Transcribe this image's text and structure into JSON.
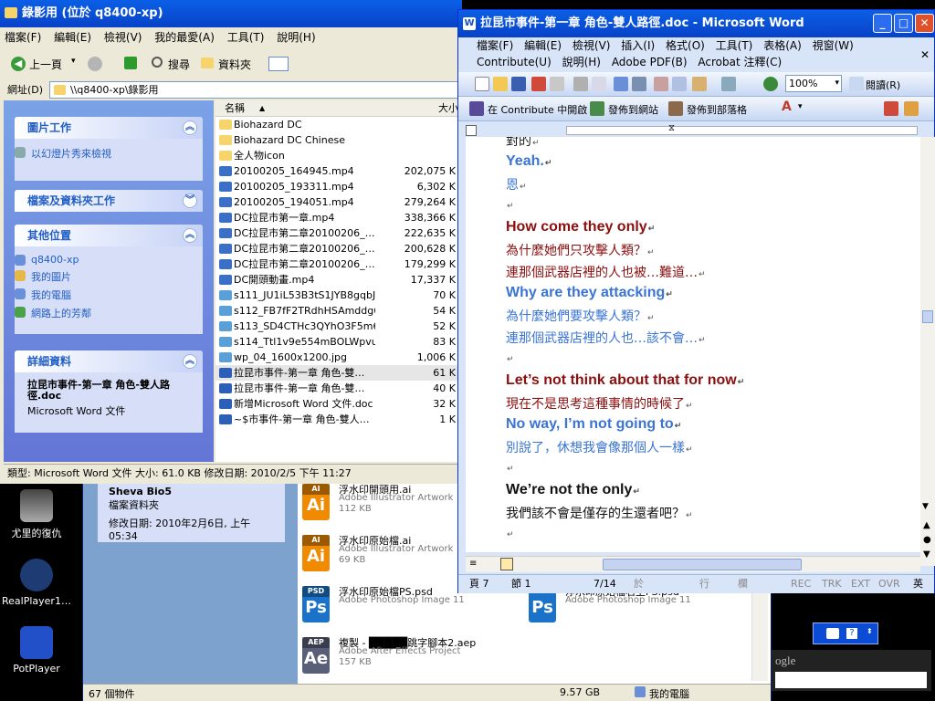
{
  "desktop": {
    "icons": [
      {
        "label": "尤里的復仇"
      },
      {
        "label": "RealPlayer1…"
      },
      {
        "label": "PotPlayer"
      }
    ]
  },
  "back_window": {
    "panel": {
      "title": "Sheva Bio5",
      "type": "檔案資料夾",
      "modified": "修改日期: 2010年2月6日, 上午 05:34"
    },
    "tiles": [
      {
        "badge": "AI",
        "glyph": "Ai",
        "name": "浮水印開頭用.ai",
        "type": "Adobe Illustrator Artwork",
        "size": "112 KB",
        "color": "#f08a00"
      },
      {
        "badge": "AI",
        "glyph": "Ai",
        "name": "浮水印原始檔.ai",
        "type": "Adobe Illustrator Artwork",
        "size": "69 KB",
        "color": "#f08a00"
      },
      {
        "badge": "PSD",
        "glyph": "Ps",
        "name": "浮水印原始檔PS.psd",
        "type": "Adobe Photoshop Image 11",
        "size": "",
        "color": "#1a73c8"
      },
      {
        "badge": "",
        "glyph": "Ps",
        "name": "浮水印原始檔右上PS.psd",
        "type": "Adobe Photoshop Image 11",
        "size": "",
        "color": "#1a73c8"
      },
      {
        "badge": "AEP",
        "glyph": "Ae",
        "name": "複製 - █████跳字腳本2.aep",
        "type": "Adobe After Effects Project",
        "size": "157 KB",
        "color": "#5a5f78"
      }
    ],
    "status": {
      "count": "67 個物件",
      "size": "9.57 GB",
      "location": "我的電腦"
    }
  },
  "explorer": {
    "title": "錄影用 (位於 q8400-xp)",
    "menu": [
      "檔案(F)",
      "編輯(E)",
      "檢視(V)",
      "我的最愛(A)",
      "工具(T)",
      "說明(H)"
    ],
    "toolbar": {
      "back": "上一頁",
      "search": "搜尋",
      "folders": "資料夾"
    },
    "address_label": "網址(D)",
    "address": "\\\\q8400-xp\\錄影用",
    "panels": {
      "picture_tasks": {
        "title": "圖片工作",
        "items": [
          "以幻燈片秀來檢視"
        ]
      },
      "file_tasks": {
        "title": "檔案及資料夾工作"
      },
      "other_places": {
        "title": "其他位置",
        "items": [
          "q8400-xp",
          "我的圖片",
          "我的電腦",
          "網路上的芳鄰"
        ]
      },
      "details": {
        "title": "詳細資料",
        "name": "拉昆市事件-第一章 角色-雙人路徑.doc",
        "type": "Microsoft Word 文件"
      }
    },
    "columns": {
      "name": "名稱",
      "size": "大小"
    },
    "files": [
      {
        "name": "Biohazard DC",
        "size": "",
        "kind": "folder"
      },
      {
        "name": "Biohazard DC Chinese",
        "size": "",
        "kind": "folder"
      },
      {
        "name": "全人物icon",
        "size": "",
        "kind": "folder"
      },
      {
        "name": "20100205_164945.mp4",
        "size": "202,075 K",
        "kind": "video"
      },
      {
        "name": "20100205_193311.mp4",
        "size": "6,302 K",
        "kind": "video"
      },
      {
        "name": "20100205_194051.mp4",
        "size": "279,264 K",
        "kind": "video"
      },
      {
        "name": "DC拉昆市第一章.mp4",
        "size": "338,366 K",
        "kind": "video"
      },
      {
        "name": "DC拉昆市第二章20100206_…",
        "size": "222,635 K",
        "kind": "video"
      },
      {
        "name": "DC拉昆市第二章20100206_…",
        "size": "200,628 K",
        "kind": "video"
      },
      {
        "name": "DC拉昆市第二章20100206_…",
        "size": "179,299 K",
        "kind": "video"
      },
      {
        "name": "DC開頭動畫.mp4",
        "size": "17,337 K",
        "kind": "video"
      },
      {
        "name": "s111_JU1iL53B3tS1JYB8gqbJ…",
        "size": "70 K",
        "kind": "image"
      },
      {
        "name": "s112_FB7fF2TRdhHSAmddg6…",
        "size": "54 K",
        "kind": "image"
      },
      {
        "name": "s113_SD4CTHc3QYhO3F5m6…",
        "size": "52 K",
        "kind": "image"
      },
      {
        "name": "s114_Ttl1v9e554mBOLWpvu…",
        "size": "83 K",
        "kind": "image"
      },
      {
        "name": "wp_04_1600x1200.jpg",
        "size": "1,006 K",
        "kind": "image"
      },
      {
        "name": "拉昆市事件-第一章 角色-雙…",
        "size": "61 K",
        "kind": "doc"
      },
      {
        "name": "拉昆市事件-第一章 角色-雙…",
        "size": "40 K",
        "kind": "doc"
      },
      {
        "name": "新增Microsoft Word 文件.doc",
        "size": "32 K",
        "kind": "doc"
      },
      {
        "name": "~$市事件-第一章 角色-雙人…",
        "size": "1 K",
        "kind": "doc"
      }
    ],
    "status": "類型: Microsoft Word 文件 大小: 61.0 KB 修改日期: 2010/2/5 下午 11:27"
  },
  "word": {
    "title": "拉昆市事件-第一章 角色-雙人路徑.doc - Microsoft Word",
    "menu_row1": [
      "檔案(F)",
      "編輯(E)",
      "檢視(V)",
      "插入(I)",
      "格式(O)",
      "工具(T)",
      "表格(A)",
      "視窗(W)"
    ],
    "menu_row2": [
      "Contribute(U)",
      "說明(H)",
      "Adobe PDF(B)",
      "Acrobat 注釋(C)"
    ],
    "zoom": "100%",
    "read_label": "閱讀(R)",
    "contribute": [
      "在 Contribute 中開啟",
      "發佈到網站",
      "發佈到部落格"
    ],
    "lines": [
      {
        "text": "對的",
        "style": "zh",
        "color": "#1a1a1a"
      },
      {
        "text": "Yeah.",
        "style": "en",
        "color": "#3a74d4"
      },
      {
        "text": "恩",
        "style": "zh",
        "color": "#3a74d4"
      },
      {
        "text": "",
        "style": "zh",
        "color": "#000000"
      },
      {
        "text": "How come they only",
        "style": "en",
        "color": "#8b0f0f"
      },
      {
        "text": "為什麼她們只攻擊人類？",
        "style": "zh",
        "color": "#8b0f0f"
      },
      {
        "text": "連那個武器店裡的人也被…難道…",
        "style": "zh",
        "color": "#8b0f0f"
      },
      {
        "text": "Why are they attacking",
        "style": "en",
        "color": "#3a74d4"
      },
      {
        "text": "為什麼她們要攻擊人類？",
        "style": "zh",
        "color": "#3a74d4"
      },
      {
        "text": "連那個武器店裡的人也…該不會…",
        "style": "zh",
        "color": "#3a74d4"
      },
      {
        "text": "",
        "style": "zh",
        "color": "#000000"
      },
      {
        "text": "Let’s not think about that for now",
        "style": "en",
        "color": "#8b0f0f"
      },
      {
        "text": "現在不是思考這種事情的時候了",
        "style": "zh",
        "color": "#8b0f0f"
      },
      {
        "text": "No way, I’m not going to",
        "style": "en",
        "color": "#3a74d4"
      },
      {
        "text": "別說了，休想我會像那個人一樣",
        "style": "zh",
        "color": "#3a74d4"
      },
      {
        "text": "",
        "style": "zh",
        "color": "#000000"
      },
      {
        "text": "We’re not the only",
        "style": "en",
        "color": "#111111"
      },
      {
        "text": "我們該不會是僅存的生還者吧？",
        "style": "zh",
        "color": "#111111"
      },
      {
        "text": "",
        "style": "zh",
        "color": "#000000"
      }
    ],
    "status": {
      "page": "頁 7",
      "section": "節 1",
      "pages": "7/14",
      "at": "於",
      "line": "行",
      "col": "欄",
      "rec": "REC",
      "trk": "TRK",
      "ext": "EXT",
      "ovr": "OVR",
      "lang": "英"
    }
  },
  "misc": {
    "google_label": "ogle"
  }
}
